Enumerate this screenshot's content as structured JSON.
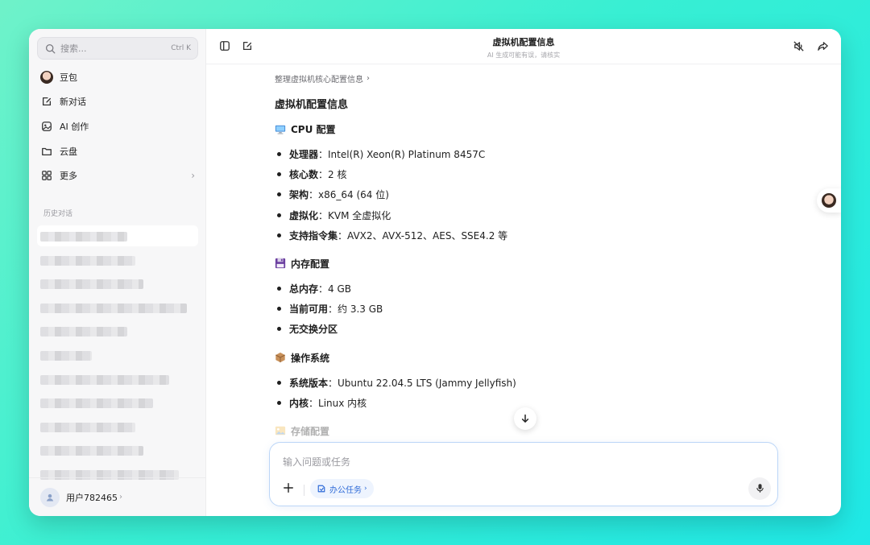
{
  "sidebar": {
    "search": {
      "placeholder": "搜索...",
      "shortcut": "Ctrl K"
    },
    "nav": [
      {
        "label": "豆包",
        "icon": "avatar-icon"
      },
      {
        "label": "新对话",
        "icon": "new-chat-icon"
      },
      {
        "label": "AI 创作",
        "icon": "image-create-icon"
      },
      {
        "label": "云盘",
        "icon": "folder-icon"
      },
      {
        "label": "更多",
        "icon": "grid-icon"
      }
    ],
    "history_label": "历史对话",
    "user": {
      "name": "用户782465"
    }
  },
  "header": {
    "title": "虚拟机配置信息",
    "subtitle": "AI 生成可能有误，请核实"
  },
  "content": {
    "breadcrumb": "整理虚拟机核心配置信息",
    "heading": "虚拟机配置信息",
    "sections": [
      {
        "title": "CPU 配置",
        "icon": "computer-emoji",
        "items": [
          {
            "label": "处理器",
            "value": "：Intel(R) Xeon(R) Platinum 8457C"
          },
          {
            "label": "核心数",
            "value": "：2 核"
          },
          {
            "label": "架构",
            "value": "：x86_64 (64 位)"
          },
          {
            "label": "虚拟化",
            "value": "：KVM 全虚拟化"
          },
          {
            "label": "支持指令集",
            "value": "：AVX2、AVX-512、AES、SSE4.2 等"
          }
        ]
      },
      {
        "title": "内存配置",
        "icon": "floppy-disk-emoji",
        "items": [
          {
            "label": "总内存",
            "value": "：4 GB"
          },
          {
            "label": "当前可用",
            "value": "：约 3.3 GB"
          },
          {
            "label": "无交换分区",
            "value": ""
          }
        ]
      },
      {
        "title": "操作系统",
        "icon": "package-emoji",
        "items": [
          {
            "label": "系统版本",
            "value": "：Ubuntu 22.04.5 LTS (Jammy Jellyfish)"
          },
          {
            "label": "内核",
            "value": "：Linux 内核"
          }
        ]
      },
      {
        "title": "存储配置",
        "icon": "image-emoji",
        "items": []
      }
    ]
  },
  "composer": {
    "placeholder": "输入问题或任务",
    "chip_label": "办公任务"
  },
  "colors": {
    "accent": "#2f6bd8",
    "background_start": "#6ff2c9",
    "background_end": "#1fe8e6"
  }
}
